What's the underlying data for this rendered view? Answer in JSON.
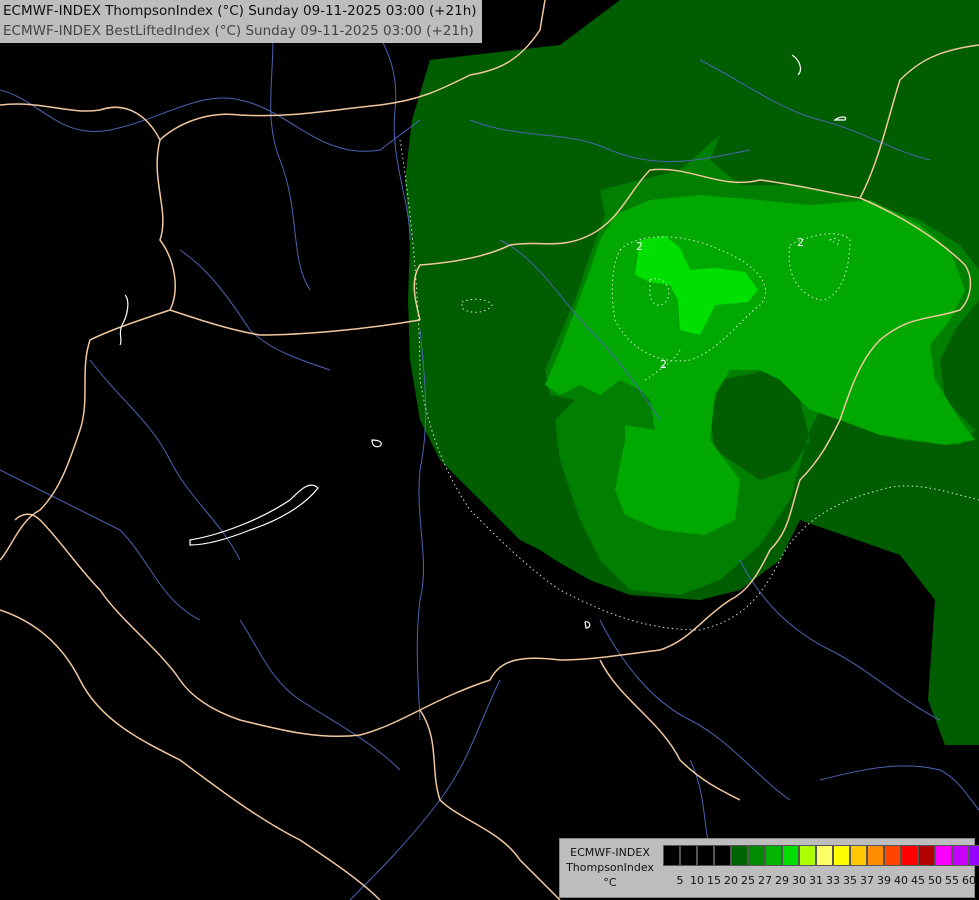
{
  "header": {
    "line1": "ECMWF-INDEX ThompsonIndex (°C) Sunday 09-11-2025 03:00 (+21h)",
    "line2": "ECMWF-INDEX BestLiftedIndex (°C) Sunday 09-11-2025 03:00 (+21h)"
  },
  "contour_labels": [
    "2",
    "2",
    "2"
  ],
  "legend": {
    "line1": "ECMWF-INDEX",
    "line2": "ThompsonIndex",
    "line3": "°C",
    "colors": [
      "#000000",
      "#000000",
      "#000000",
      "#000000",
      "#006400",
      "#008c00",
      "#00b400",
      "#00dc00",
      "#aaff00",
      "#ffff66",
      "#ffff00",
      "#ffc800",
      "#ff8c00",
      "#ff4500",
      "#ff0000",
      "#b40000",
      "#ff00ff",
      "#c800ff",
      "#9600ff",
      "#6400ff",
      "#0000ff"
    ],
    "ticks": [
      "5",
      "10",
      "15",
      "20",
      "25",
      "27",
      "29",
      "30",
      "31",
      "33",
      "35",
      "37",
      "39",
      "40",
      "45",
      "50",
      "55",
      "60"
    ]
  },
  "colors": {
    "ti_20_25": "#005e00",
    "ti_25_27": "#007f00",
    "ti_27_29": "#00a800",
    "ti_29_30": "#00e000",
    "borders": "#f0c8a0",
    "rivers": "#4a64b0",
    "lakes": "#ffffff"
  }
}
